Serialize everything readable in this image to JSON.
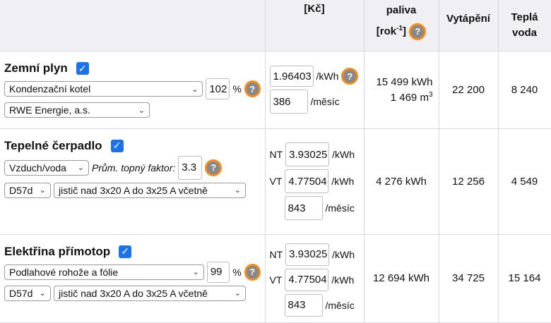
{
  "header": {
    "price_unit": "[Kč]",
    "fuel_label": "paliva",
    "rok_label": "[rok",
    "rok_sup": "-1",
    "rok_close": "]",
    "heating": "Vytápění",
    "hot_water_line1": "Teplá",
    "hot_water_line2": "voda"
  },
  "rows": [
    {
      "title": "Zemní plyn",
      "device": "Kondenzační kotel",
      "efficiency": "102",
      "efficiency_unit": "%",
      "supplier": "RWE Energie, a.s.",
      "price": "1.96403",
      "price_unit": "/kWh",
      "monthly": "386",
      "monthly_unit": "/měsíc",
      "consumption_kwh": "15 499 kWh",
      "consumption_m3": "1 469 m",
      "consumption_m3_sup": "3",
      "heating": "22 200",
      "hot_water": "8 240"
    },
    {
      "title": "Tepelné čerpadlo",
      "device": "Vzduch/voda",
      "factor_label": "Prům. topný faktor:",
      "factor": "3.3",
      "tariff": "D57d",
      "breaker": "jistič nad 3x20 A do 3x25 A včetně",
      "nt_label": "NT",
      "nt_price": "3.93025",
      "vt_label": "VT",
      "vt_price": "4.77504",
      "price_unit": "/kWh",
      "monthly": "843",
      "monthly_unit": "/měsíc",
      "consumption_kwh": "4 276 kWh",
      "heating": "12 256",
      "hot_water": "4 549"
    },
    {
      "title": "Elektřina přímotop",
      "device": "Podlahové rohože a fólie",
      "efficiency": "99",
      "efficiency_unit": "%",
      "tariff": "D57d",
      "breaker": "jistič nad 3x20 A do 3x25 A včetně",
      "nt_label": "NT",
      "nt_price": "3.93025",
      "vt_label": "VT",
      "vt_price": "4.77504",
      "price_unit": "/kWh",
      "monthly": "843",
      "monthly_unit": "/měsíc",
      "consumption_kwh": "12 694 kWh",
      "heating": "34 725",
      "hot_water": "15 164"
    }
  ],
  "icons": {
    "help": "help-icon",
    "check": "checkbox-checked-icon",
    "chevron": "chevron-down-icon"
  },
  "colors": {
    "accent": "#1a73e8",
    "help_ring": "#f28c1f",
    "header_bg": "#f0f0f4"
  }
}
